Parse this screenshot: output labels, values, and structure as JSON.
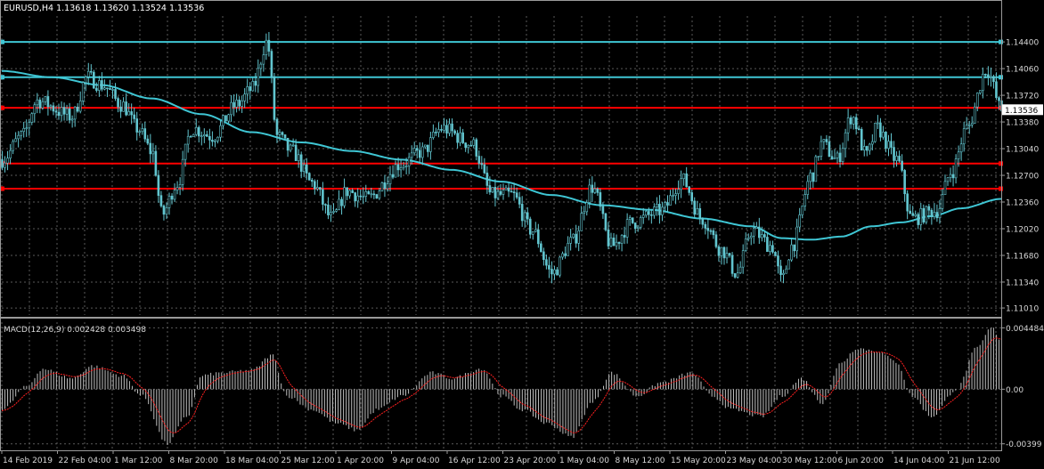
{
  "chart_data": {
    "type": "candlestick",
    "symbol_header": "EURUSD,H4  1.13618 1.13620 1.13524 1.13536",
    "price_axis": {
      "ticks": [
        "1.14400",
        "1.14060",
        "1.13720",
        "1.13380",
        "1.13040",
        "1.12700",
        "1.12360",
        "1.12020",
        "1.11680",
        "1.11340",
        "1.11010"
      ],
      "tick_values": [
        1.144,
        1.1406,
        1.1372,
        1.1338,
        1.1304,
        1.127,
        1.1236,
        1.1202,
        1.1168,
        1.1134,
        1.1101
      ],
      "range": [
        1.1092,
        1.1473
      ],
      "current_price_label": "1.13536",
      "current_price": 1.13536
    },
    "time_axis": {
      "labels": [
        "14 Feb 2019",
        "22 Feb 04:00",
        "1 Mar 12:00",
        "8 Mar 20:00",
        "18 Mar 04:00",
        "25 Mar 12:00",
        "1 Apr 20:00",
        "9 Apr 04:00",
        "16 Apr 12:00",
        "23 Apr 20:00",
        "1 May 04:00",
        "8 May 12:00",
        "15 May 20:00",
        "23 May 04:00",
        "30 May 12:00",
        "6 Jun 20:00",
        "14 Jun 04:00",
        "21 Jun 12:00"
      ]
    },
    "price_series": {
      "name": "",
      "keypoints": [
        [
          0,
          1.129
        ],
        [
          0.02,
          1.132
        ],
        [
          0.035,
          1.1365
        ],
        [
          0.07,
          1.1345
        ],
        [
          0.085,
          1.1395
        ],
        [
          0.1,
          1.1385
        ],
        [
          0.12,
          1.136
        ],
        [
          0.135,
          1.133
        ],
        [
          0.15,
          1.13
        ],
        [
          0.16,
          1.122
        ],
        [
          0.175,
          1.126
        ],
        [
          0.19,
          1.133
        ],
        [
          0.21,
          1.132
        ],
        [
          0.235,
          1.136
        ],
        [
          0.25,
          1.138
        ],
        [
          0.265,
          1.144
        ],
        [
          0.275,
          1.132
        ],
        [
          0.29,
          1.13
        ],
        [
          0.31,
          1.126
        ],
        [
          0.33,
          1.1215
        ],
        [
          0.345,
          1.125
        ],
        [
          0.365,
          1.124
        ],
        [
          0.4,
          1.1285
        ],
        [
          0.42,
          1.13
        ],
        [
          0.44,
          1.133
        ],
        [
          0.47,
          1.131
        ],
        [
          0.49,
          1.1245
        ],
        [
          0.51,
          1.1245
        ],
        [
          0.53,
          1.12
        ],
        [
          0.55,
          1.1145
        ],
        [
          0.57,
          1.1185
        ],
        [
          0.59,
          1.1255
        ],
        [
          0.61,
          1.118
        ],
        [
          0.63,
          1.121
        ],
        [
          0.66,
          1.1225
        ],
        [
          0.68,
          1.1265
        ],
        [
          0.7,
          1.1215
        ],
        [
          0.72,
          1.1175
        ],
        [
          0.735,
          1.1145
        ],
        [
          0.75,
          1.12
        ],
        [
          0.77,
          1.118
        ],
        [
          0.78,
          1.1135
        ],
        [
          0.79,
          1.118
        ],
        [
          0.81,
          1.127
        ],
        [
          0.82,
          1.131
        ],
        [
          0.835,
          1.129
        ],
        [
          0.85,
          1.1345
        ],
        [
          0.865,
          1.1295
        ],
        [
          0.875,
          1.133
        ],
        [
          0.895,
          1.129
        ],
        [
          0.91,
          1.1215
        ],
        [
          0.935,
          1.1225
        ],
        [
          0.95,
          1.1275
        ],
        [
          0.965,
          1.133
        ],
        [
          0.985,
          1.1405
        ],
        [
          1.0,
          1.13536
        ]
      ]
    },
    "moving_average": {
      "name": "",
      "color": "#3fc6d4",
      "keypoints": [
        [
          0,
          1.1403
        ],
        [
          0.05,
          1.1395
        ],
        [
          0.1,
          1.1385
        ],
        [
          0.15,
          1.1368
        ],
        [
          0.2,
          1.1348
        ],
        [
          0.25,
          1.1325
        ],
        [
          0.3,
          1.1312
        ],
        [
          0.35,
          1.1301
        ],
        [
          0.4,
          1.129
        ],
        [
          0.45,
          1.1277
        ],
        [
          0.5,
          1.1262
        ],
        [
          0.55,
          1.1245
        ],
        [
          0.6,
          1.1232
        ],
        [
          0.65,
          1.1226
        ],
        [
          0.7,
          1.1215
        ],
        [
          0.75,
          1.1205
        ],
        [
          0.78,
          1.119
        ],
        [
          0.81,
          1.1188
        ],
        [
          0.84,
          1.1192
        ],
        [
          0.87,
          1.1205
        ],
        [
          0.9,
          1.121
        ],
        [
          0.93,
          1.1218
        ],
        [
          0.96,
          1.1228
        ],
        [
          1.0,
          1.124
        ]
      ]
    },
    "horizontal_lines": [
      {
        "price": 1.144,
        "color": "#3fc6d4"
      },
      {
        "price": 1.1395,
        "color": "#3fc6d4"
      },
      {
        "price": 1.1356,
        "color": "#ff0000"
      },
      {
        "price": 1.1285,
        "color": "#ff0000"
      },
      {
        "price": 1.1253,
        "color": "#ff0000"
      }
    ],
    "macd": {
      "header": "MACD(12,26,9) 0.002428 0.003498",
      "ticks": [
        "0.004484",
        "0.00",
        "-0.00399"
      ],
      "tick_values": [
        0.004484,
        0.0,
        -0.00399
      ],
      "range": [
        -0.0044,
        0.0049
      ],
      "signal_color": "#ff2020",
      "histogram_color": "#c0c0c0",
      "keypoints": [
        [
          0,
          -0.0015
        ],
        [
          0.025,
          0.0002
        ],
        [
          0.04,
          0.0015
        ],
        [
          0.07,
          0.0008
        ],
        [
          0.09,
          0.0017
        ],
        [
          0.12,
          0.001
        ],
        [
          0.14,
          -0.0005
        ],
        [
          0.165,
          -0.004
        ],
        [
          0.185,
          -0.002
        ],
        [
          0.2,
          0.001
        ],
        [
          0.22,
          0.0012
        ],
        [
          0.25,
          0.0014
        ],
        [
          0.27,
          0.0025
        ],
        [
          0.285,
          -0.0005
        ],
        [
          0.31,
          -0.0015
        ],
        [
          0.335,
          -0.0025
        ],
        [
          0.355,
          -0.003
        ],
        [
          0.375,
          -0.0015
        ],
        [
          0.4,
          -0.0005
        ],
        [
          0.43,
          0.0012
        ],
        [
          0.45,
          0.0008
        ],
        [
          0.48,
          0.0015
        ],
        [
          0.5,
          -0.0005
        ],
        [
          0.52,
          -0.0015
        ],
        [
          0.545,
          -0.0025
        ],
        [
          0.57,
          -0.0035
        ],
        [
          0.59,
          -0.001
        ],
        [
          0.61,
          0.0012
        ],
        [
          0.635,
          -0.0005
        ],
        [
          0.66,
          0.0005
        ],
        [
          0.69,
          0.0012
        ],
        [
          0.71,
          -0.0005
        ],
        [
          0.73,
          -0.0015
        ],
        [
          0.76,
          -0.002
        ],
        [
          0.78,
          -0.0005
        ],
        [
          0.8,
          0.0008
        ],
        [
          0.82,
          -0.001
        ],
        [
          0.84,
          0.002
        ],
        [
          0.855,
          0.003
        ],
        [
          0.875,
          0.0028
        ],
        [
          0.895,
          0.002
        ],
        [
          0.91,
          -0.0005
        ],
        [
          0.93,
          -0.002
        ],
        [
          0.955,
          0.0
        ],
        [
          0.975,
          0.003
        ],
        [
          0.99,
          0.0045
        ],
        [
          1.0,
          0.0035
        ]
      ]
    },
    "colors": {
      "background": "#000000",
      "grid": "#5a5a5a",
      "candle": "#62c6d0",
      "text": "#d8d8d8"
    }
  }
}
